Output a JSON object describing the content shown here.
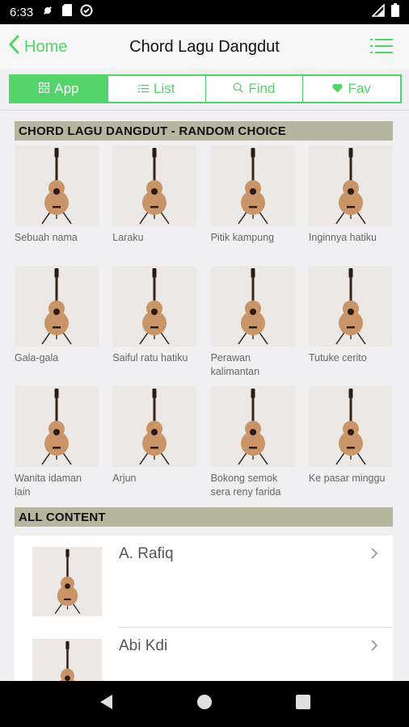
{
  "status_bar": {
    "time": "6:33"
  },
  "header": {
    "back_label": "Home",
    "title": "Chord Lagu Dangdut"
  },
  "tabs": [
    {
      "label": "App",
      "icon": "grid-icon"
    },
    {
      "label": "List",
      "icon": "list-icon"
    },
    {
      "label": "Find",
      "icon": "search-icon"
    },
    {
      "label": "Fav",
      "icon": "heart-icon"
    }
  ],
  "random_section": {
    "title": "CHORD LAGU DANGDUT - RANDOM CHOICE",
    "items": [
      "Sebuah nama",
      "Laraku",
      "Pitik kampung",
      "Inginnya hatiku",
      "Gala-gala",
      "Saiful ratu hatiku",
      "Perawan kalimantan",
      "Tutuke cerito",
      "Wanita idaman lain",
      "Arjun",
      "Bokong semok sera reny farida",
      "Ke pasar minggu"
    ]
  },
  "all_content": {
    "title": "ALL CONTENT",
    "items": [
      "A. Rafiq",
      "Abi Kdi"
    ]
  },
  "colors": {
    "accent": "#53d46a",
    "section_bg": "#b6b59f"
  }
}
